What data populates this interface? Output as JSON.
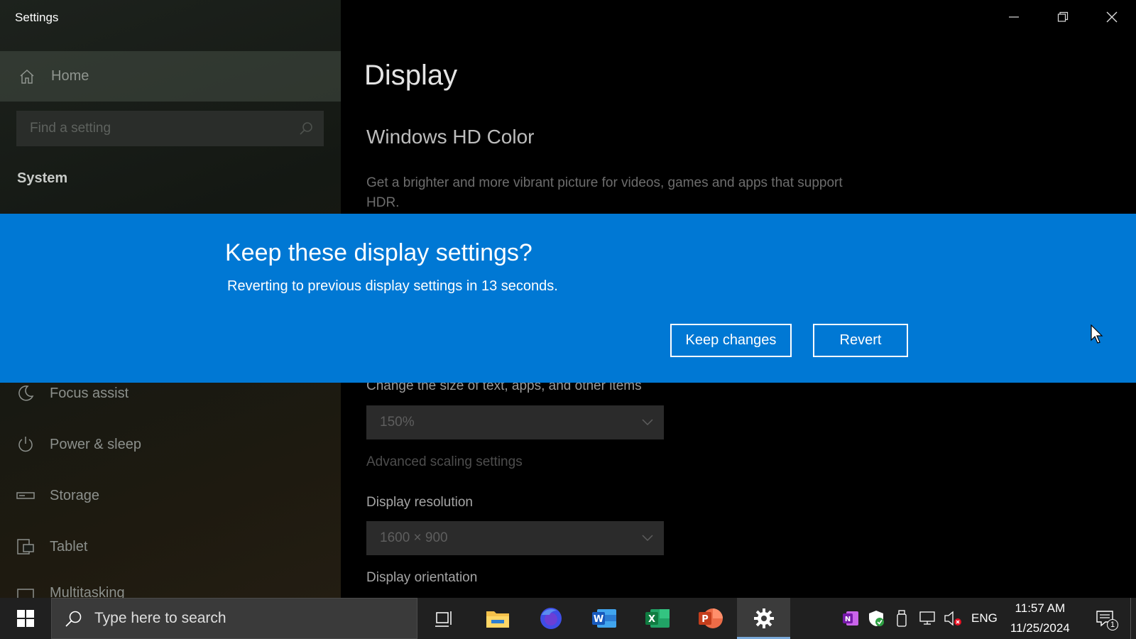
{
  "window": {
    "title": "Settings"
  },
  "sidebar": {
    "home": "Home",
    "search_placeholder": "Find a setting",
    "section": "System",
    "items": [
      {
        "label": "Focus assist",
        "icon": "moon-icon"
      },
      {
        "label": "Power & sleep",
        "icon": "power-icon"
      },
      {
        "label": "Storage",
        "icon": "storage-icon"
      },
      {
        "label": "Tablet",
        "icon": "tablet-icon"
      },
      {
        "label": "Multitasking",
        "icon": "multitasking-icon"
      }
    ]
  },
  "main": {
    "title": "Display",
    "hdr_title": "Windows HD Color",
    "hdr_desc": "Get a brighter and more vibrant picture for videos, games and apps that support HDR.",
    "scale_label": "Change the size of text, apps, and other items",
    "scale_value": "150%",
    "advanced_link": "Advanced scaling settings",
    "resolution_label": "Display resolution",
    "resolution_value": "1600 × 900",
    "orientation_label": "Display orientation"
  },
  "dialog": {
    "title": "Keep these display settings?",
    "message": "Reverting to previous display settings in 13 seconds.",
    "keep_label": "Keep changes",
    "revert_label": "Revert",
    "color": "#0078d4"
  },
  "taskbar": {
    "search_placeholder": "Type here to search",
    "apps": [
      "task-view",
      "file-explorer",
      "firefox",
      "word",
      "excel",
      "powerpoint",
      "settings"
    ],
    "language": "ENG",
    "time": "11:57 AM",
    "date": "11/25/2024",
    "notification_count": "1"
  }
}
